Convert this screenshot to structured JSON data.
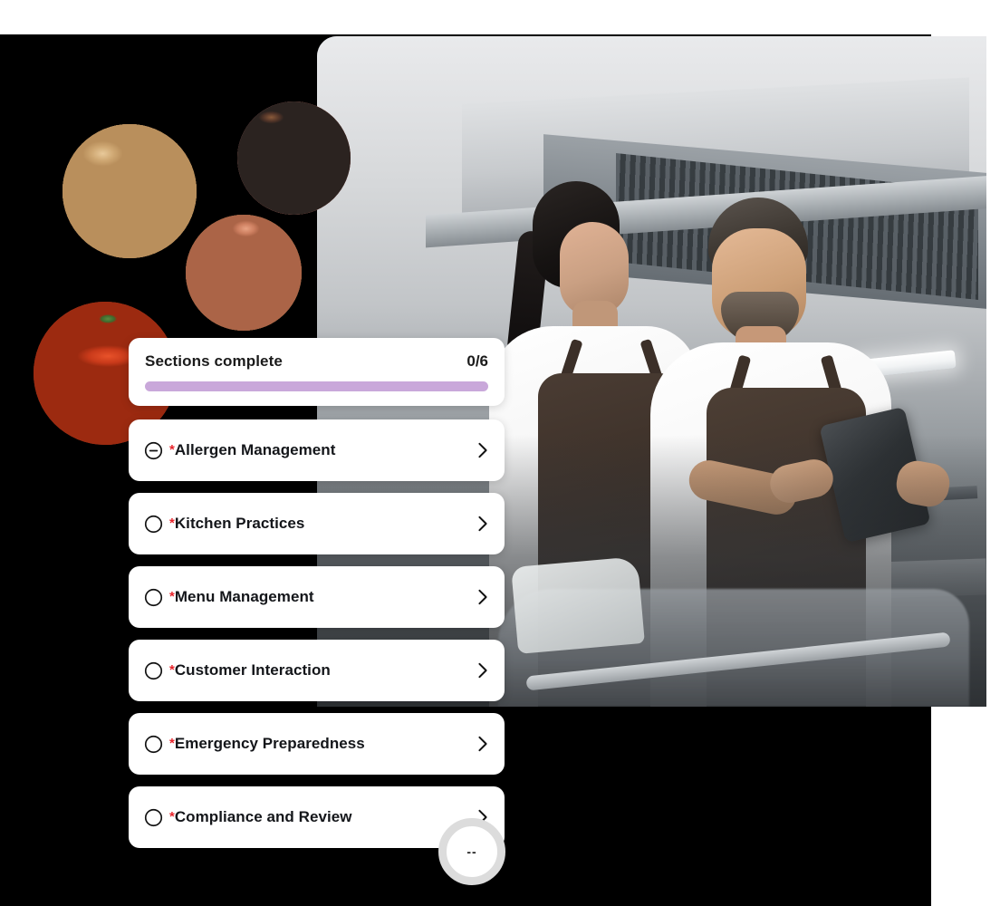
{
  "progress": {
    "label": "Sections complete",
    "count_text": "0/6",
    "completed": 0,
    "total": 6,
    "percent": 0,
    "track_color": "#c9a8da",
    "fill_color": "#7b3fa0"
  },
  "indicator": {
    "value_text": "--",
    "ring_color": "#dcdcdc"
  },
  "required_marker": "*",
  "required_color": "#e8242b",
  "sections": [
    {
      "title": "Allergen Management",
      "status": "partial",
      "status_icon": "circle-minus-icon",
      "chevron_icon": "chevron-right-icon"
    },
    {
      "title": "Kitchen Practices",
      "status": "incomplete",
      "status_icon": "circle-empty-icon",
      "chevron_icon": "chevron-right-icon"
    },
    {
      "title": "Menu Management",
      "status": "incomplete",
      "status_icon": "circle-empty-icon",
      "chevron_icon": "chevron-right-icon"
    },
    {
      "title": "Customer Interaction",
      "status": "incomplete",
      "status_icon": "circle-empty-icon",
      "chevron_icon": "chevron-right-icon"
    },
    {
      "title": "Emergency Preparedness",
      "status": "incomplete",
      "status_icon": "circle-empty-icon",
      "chevron_icon": "chevron-right-icon"
    },
    {
      "title": "Compliance and Review",
      "status": "incomplete",
      "status_icon": "circle-empty-icon",
      "chevron_icon": "chevron-right-icon"
    }
  ],
  "allergen_images": [
    {
      "name": "peanuts-image",
      "alt": "Peanuts in shells"
    },
    {
      "name": "salmon-image",
      "alt": "Raw salmon fillets on slate"
    },
    {
      "name": "mixed-nuts-image",
      "alt": "Mixed nuts — almonds, cashews, peanuts"
    },
    {
      "name": "shellfish-image",
      "alt": "Cooked lobster / crayfish on a platter"
    }
  ],
  "hero_photo": {
    "name": "kitchen-staff-photo",
    "alt": "Two chefs in white shirts and brown aprons reviewing a tablet in a commercial kitchen"
  }
}
